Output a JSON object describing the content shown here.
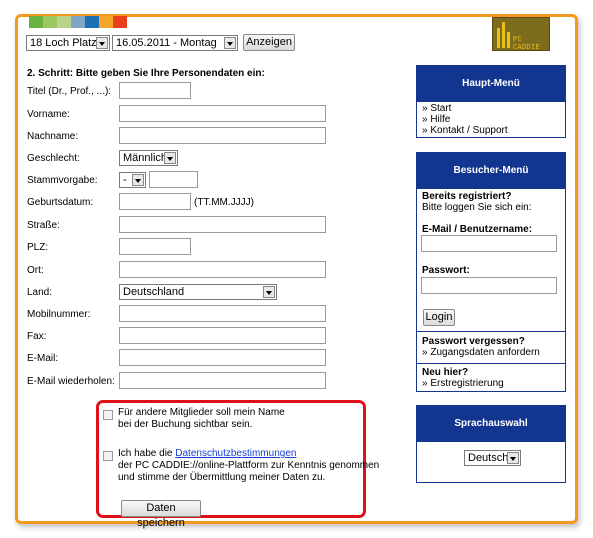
{
  "colors": {
    "frame_border": "#f29a1f",
    "panel_blue": "#12358f",
    "highlight_red": "#e0101a",
    "link": "#1a3ecf",
    "strip": [
      "#6ab23e",
      "#9cc862",
      "#b8d48a",
      "#7fa6c7",
      "#1f6fb5",
      "#f4a52a",
      "#e8401c"
    ]
  },
  "logo": {
    "text": "PC CADDIE",
    "icon": "golf-bars-logo"
  },
  "toolbar": {
    "course_select": "18 Loch Platz",
    "date_select": "16.05.2011 - Montag",
    "show_button": "Anzeigen"
  },
  "form": {
    "step_title": "2. Schritt: Bitte geben Sie Ihre Personendaten ein:",
    "fields": {
      "titel": "Titel (Dr., Prof., ...):",
      "vorname": "Vorname:",
      "nachname": "Nachname:",
      "geschlecht": "Geschlecht:",
      "geschlecht_value": "Männlich",
      "stammvorgabe": "Stammvorgabe:",
      "stammvorgabe_sign": "-",
      "geburtsdatum": "Geburtsdatum:",
      "geburtsdatum_hint": "(TT.MM.JJJJ)",
      "strasse": "Straße:",
      "plz": "PLZ:",
      "ort": "Ort:",
      "land": "Land:",
      "land_value": "Deutschland",
      "mobil": "Mobilnummer:",
      "fax": "Fax:",
      "email": "E-Mail:",
      "email_repeat": "E-Mail wiederholen:"
    },
    "consent": {
      "visibility_line1": "Für andere Mitglieder soll mein Name",
      "visibility_line2": "bei der Buchung sichtbar sein.",
      "privacy_prefix": "Ich habe die ",
      "privacy_link": "Datenschutzbestimmungen",
      "privacy_line2": "der PC CADDIE://online-Plattform zur Kenntnis genommen",
      "privacy_line3": "und stimme der Übermittlung meiner Daten zu.",
      "visibility_checked": false,
      "privacy_checked": false
    },
    "save_button": "Daten speichern"
  },
  "sidebar": {
    "main_menu": {
      "title": "Haupt-Menü",
      "items": [
        "» Start",
        "» Hilfe",
        "» Kontakt / Support"
      ]
    },
    "visitor_menu": {
      "title": "Besucher-Menü",
      "registered_heading": "Bereits registriert?",
      "registered_text": "Bitte loggen Sie sich ein:",
      "email_label": "E-Mail / Benutzername:",
      "password_label": "Passwort:",
      "login_button": "Login",
      "forgot_heading": "Passwort vergessen?",
      "forgot_link": "» Zugangsdaten anfordern",
      "new_heading": "Neu hier?",
      "new_link": "» Erstregistrierung"
    },
    "language": {
      "title": "Sprachauswahl",
      "selected": "Deutsch"
    }
  }
}
